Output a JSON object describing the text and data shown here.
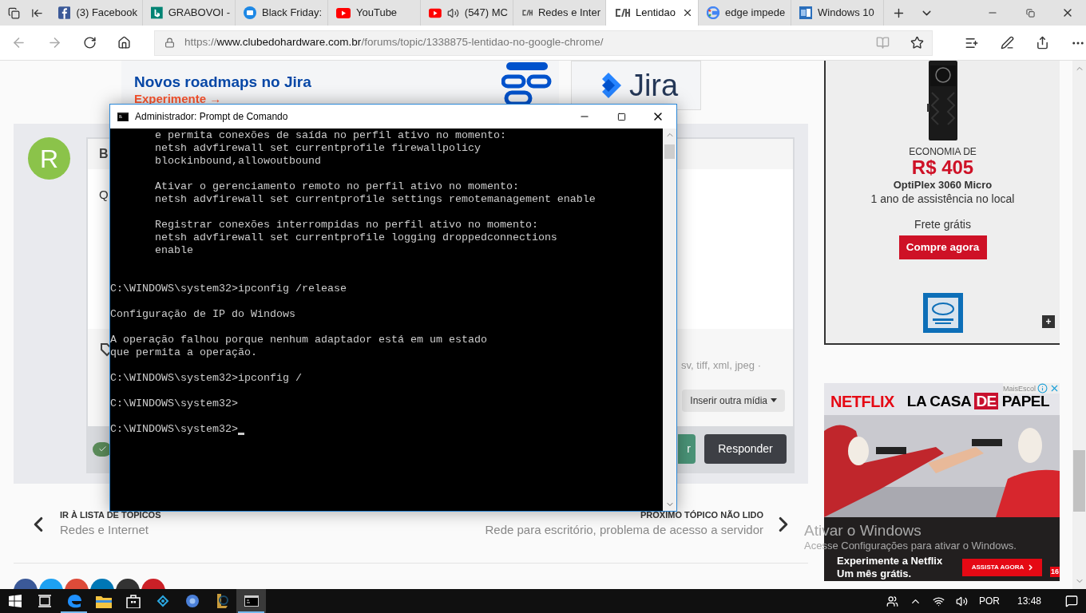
{
  "browser": {
    "tabs": [
      {
        "label": "(3) Facebook",
        "kind": "facebook",
        "audio": false,
        "selected": false
      },
      {
        "label": "GRABOVOI -",
        "kind": "bing",
        "audio": false,
        "selected": false
      },
      {
        "label": "Black Friday:",
        "kind": "ring",
        "audio": false,
        "selected": false
      },
      {
        "label": "YouTube",
        "kind": "youtube",
        "audio": false,
        "selected": false
      },
      {
        "label": "(547) MC",
        "kind": "youtube",
        "audio": true,
        "selected": false
      },
      {
        "label": "Redes e Inter",
        "kind": "forum",
        "audio": false,
        "selected": false
      },
      {
        "label": "Lentidao",
        "kind": "forum",
        "audio": false,
        "selected": true
      },
      {
        "label": "edge impede",
        "kind": "google",
        "audio": false,
        "selected": false
      },
      {
        "label": "Windows 10",
        "kind": "ms",
        "audio": false,
        "selected": false
      }
    ],
    "url": {
      "scheme": "https://",
      "host": "www.clubedohardware.com.br",
      "path": "/forums/topic/1338875-lentidao-no-google-chrome/"
    }
  },
  "page": {
    "jira_ad": {
      "headline": "Novos roadmaps no Jira",
      "cta": "Experimente →",
      "brand": "Jira"
    },
    "post": {
      "checked": true,
      "avatar": "R",
      "author": "B",
      "body": "Q",
      "formats": "sv, tiff, xml, jpeg ·",
      "media_button": "Inserir outra mídia",
      "submit_button": "r",
      "reply_button": "Responder"
    },
    "nav": {
      "prev": {
        "label": "IR À LISTA DE TÓPICOS",
        "title": "Redes e Internet"
      },
      "next": {
        "label": "PRÓXIMO TÓPICO NÃO LIDO",
        "title": "Rede para escritório, problema de acesso a servidor"
      }
    },
    "share": [
      {
        "color": "#3b5998"
      },
      {
        "color": "#1da1f2"
      },
      {
        "color": "#dd4b39"
      },
      {
        "color": "#0077b5"
      },
      {
        "color": "#333333"
      },
      {
        "color": "#cb2027"
      }
    ],
    "dell_ad": {
      "eyebrow": "ECONOMIA DE",
      "price": "R$ 405",
      "product": "OptiPlex 3060 Micro",
      "warranty": "1 ano de assistência no local",
      "shipping": "Frete grátis",
      "button": "Compre agora",
      "expand": "+"
    },
    "netflix_ad": {
      "brand": "NETFLIX",
      "title_before": "LA CASA",
      "title_boxed": "DE",
      "title_after": "PAPEL",
      "sponsor": "MaisEscol",
      "headline": "Experimente a Netflix",
      "subline": "Um mês grátis.",
      "button": "ASSISTA AGORA",
      "rating": "16"
    }
  },
  "activation": {
    "title": "Ativar o Windows",
    "text": "Acesse Configurações para ativar o Windows."
  },
  "console": {
    "title": "Administrador: Prompt de Comando",
    "blocks": [
      {
        "kind": "paragraph",
        "cursor": false,
        "lines": [
          "       e permita conexões de saída no perfil ativo no momento:",
          "       netsh advfirewall set currentprofile firewallpolicy",
          "       blockinbound,allowoutbound"
        ]
      },
      {
        "kind": "paragraph",
        "cursor": false,
        "lines": [
          "       Ativar o gerenciamento remoto no perfil ativo no momento:",
          "       netsh advfirewall set currentprofile settings remotemanagement enable"
        ]
      },
      {
        "kind": "section",
        "cursor": false,
        "lines": [
          "       Registrar conexões interrompidas no perfil ativo no momento:",
          "       netsh advfirewall set currentprofile logging droppedconnections",
          "       enable"
        ]
      },
      {
        "kind": "paragraph",
        "cursor": false,
        "lines": [
          "C:\\WINDOWS\\system32>ipconfig /release"
        ]
      },
      {
        "kind": "paragraph",
        "cursor": false,
        "lines": [
          "Configuração de IP do Windows"
        ]
      },
      {
        "kind": "paragraph",
        "cursor": false,
        "lines": [
          "A operação falhou porque nenhum adaptador está em um estado",
          "que permita a operação."
        ]
      },
      {
        "kind": "paragraph",
        "cursor": false,
        "lines": [
          "C:\\WINDOWS\\system32>ipconfig /"
        ]
      },
      {
        "kind": "paragraph",
        "cursor": false,
        "lines": [
          "C:\\WINDOWS\\system32>"
        ]
      },
      {
        "kind": "last",
        "cursor": true,
        "lines": [
          "C:\\WINDOWS\\system32>"
        ]
      }
    ]
  },
  "taskbar": {
    "apps": [
      {
        "kind": "start",
        "open": false,
        "selected": false
      },
      {
        "kind": "taskview",
        "open": false,
        "selected": false
      },
      {
        "kind": "edge",
        "open": true,
        "selected": false
      },
      {
        "kind": "explorer",
        "open": false,
        "selected": false
      },
      {
        "kind": "store",
        "open": false,
        "selected": false
      },
      {
        "kind": "network_app",
        "open": false,
        "selected": false
      },
      {
        "kind": "browser",
        "open": false,
        "selected": false
      },
      {
        "kind": "game",
        "open": false,
        "selected": false
      },
      {
        "kind": "console",
        "open": true,
        "selected": true
      }
    ],
    "language": "POR",
    "time": "13:48"
  }
}
